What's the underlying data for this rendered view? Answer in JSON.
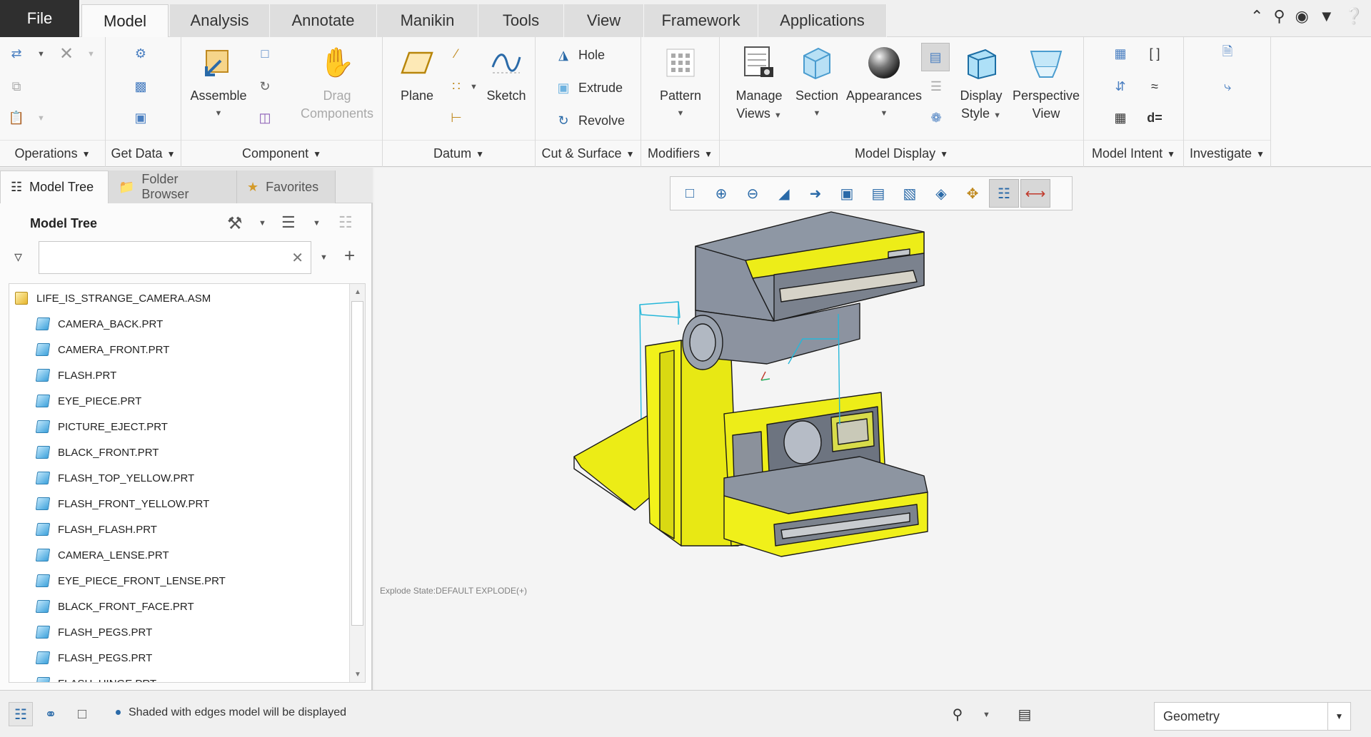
{
  "tabs": [
    "File",
    "Model",
    "Analysis",
    "Annotate",
    "Manikin",
    "Tools",
    "View",
    "Framework",
    "Applications"
  ],
  "active_tab": "Model",
  "ribbon": {
    "groups": {
      "operations": "Operations",
      "get_data": "Get Data",
      "component": "Component",
      "datum": "Datum",
      "cut_surface": "Cut & Surface",
      "modifiers": "Modifiers",
      "model_display": "Model Display",
      "model_intent": "Model Intent",
      "investigate": "Investigate"
    },
    "buttons": {
      "assemble": "Assemble",
      "drag_components_1": "Drag",
      "drag_components_2": "Components",
      "plane": "Plane",
      "sketch": "Sketch",
      "hole": "Hole",
      "extrude": "Extrude",
      "revolve": "Revolve",
      "pattern": "Pattern",
      "manage_views_1": "Manage",
      "manage_views_2": "Views",
      "section": "Section",
      "appearances": "Appearances",
      "display_style_1": "Display",
      "display_style_2": "Style",
      "perspective_view_1": "Perspective",
      "perspective_view_2": "View"
    }
  },
  "panel": {
    "tabs": [
      "Model Tree",
      "Folder Browser",
      "Favorites"
    ],
    "title": "Model Tree",
    "filter_value": ""
  },
  "tree": {
    "root": "LIFE_IS_STRANGE_CAMERA.ASM",
    "items": [
      "CAMERA_BACK.PRT",
      "CAMERA_FRONT.PRT",
      "FLASH.PRT",
      "EYE_PIECE.PRT",
      "PICTURE_EJECT.PRT",
      "BLACK_FRONT.PRT",
      "FLASH_TOP_YELLOW.PRT",
      "FLASH_FRONT_YELLOW.PRT",
      "FLASH_FLASH.PRT",
      "CAMERA_LENSE.PRT",
      "EYE_PIECE_FRONT_LENSE.PRT",
      "BLACK_FRONT_FACE.PRT",
      "FLASH_PEGS.PRT",
      "FLASH_PEGS.PRT",
      "FLASH_HINGE.PRT"
    ]
  },
  "viewport": {
    "explode_state": "Explode State:DEFAULT EXPLODE(+)"
  },
  "status": {
    "message": "Shaded with edges model will be displayed",
    "selection_filter": "Geometry"
  },
  "colors": {
    "model_yellow": "#ecec16",
    "model_gray": "#8f98a6",
    "datum_cyan": "#26b7d9",
    "accent_blue": "#2a6aa8"
  }
}
